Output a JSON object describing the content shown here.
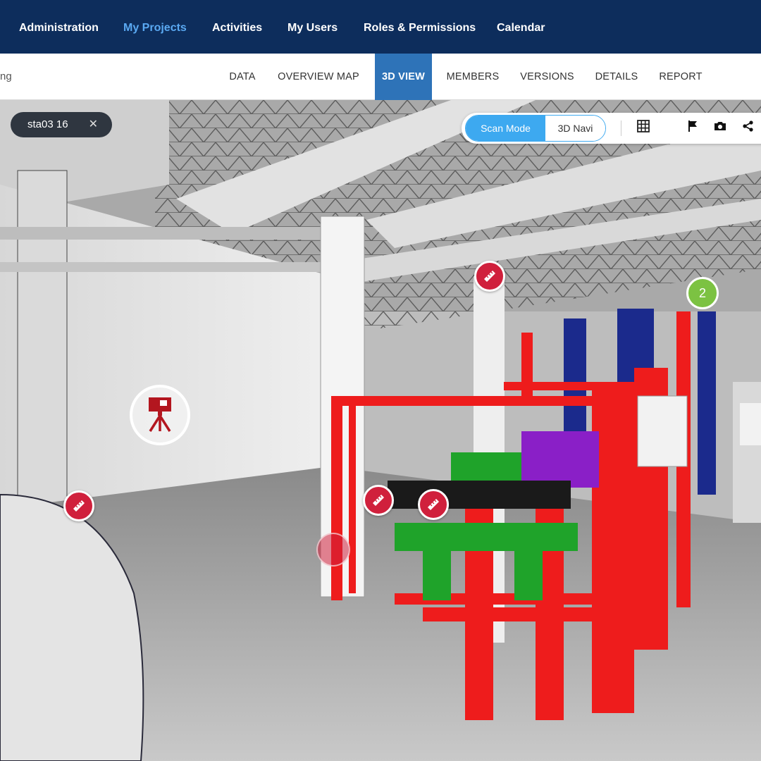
{
  "topnav": {
    "items": [
      {
        "label": "Administration"
      },
      {
        "label": "My Projects"
      },
      {
        "label": "Activities"
      },
      {
        "label": "My Users"
      },
      {
        "label": "Roles & Permissions"
      },
      {
        "label": "Calendar"
      }
    ],
    "active": "My Projects"
  },
  "subheader": {
    "project_name_fragment": "ng",
    "tabs": [
      {
        "label": "DATA"
      },
      {
        "label": "OVERVIEW MAP"
      },
      {
        "label": "3D VIEW"
      },
      {
        "label": "MEMBERS"
      },
      {
        "label": "VERSIONS"
      },
      {
        "label": "DETAILS"
      },
      {
        "label": "REPORT"
      }
    ],
    "active_tab": "3D VIEW"
  },
  "viewer": {
    "scan_chip": {
      "label": "sta03 16",
      "close_icon": "close-icon"
    },
    "mode_toggle": {
      "active": "Scan Mode",
      "inactive": "3D Navi"
    },
    "tools": [
      "grid-icon",
      "flag-icon",
      "camera-icon",
      "share-icon"
    ],
    "cluster_badge": "2",
    "markers": [
      "measure-icon",
      "measure-icon",
      "measure-icon",
      "measure-icon"
    ],
    "scanner_icon": "tripod-scanner-icon"
  },
  "colors": {
    "nav_bg": "#0d2d5c",
    "nav_active": "#5aa9f2",
    "tab_active": "#2e73b8",
    "toggle_active": "#3da9f0",
    "marker": "#d0203c",
    "badge": "#7cc242",
    "frame_red": "#ee1c1c",
    "frame_green": "#1fa32a",
    "frame_blue": "#1b2a8c"
  }
}
